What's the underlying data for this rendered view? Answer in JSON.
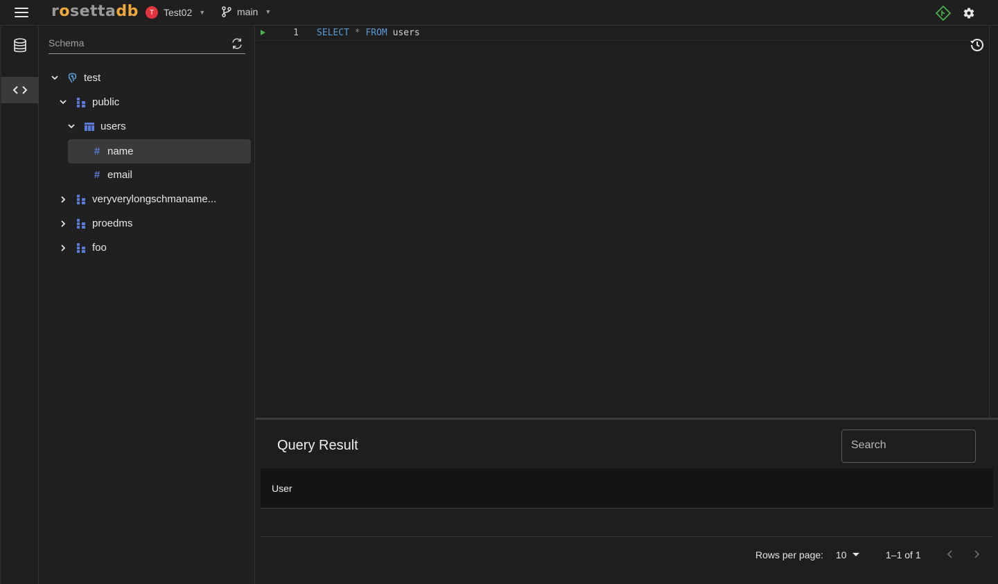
{
  "app": {
    "logo_part1": "r",
    "logo_part2": "setta",
    "logo_part3": "db",
    "org_avatar_letter": "T",
    "org_name": "Test02",
    "branch_name": "main"
  },
  "schema": {
    "search_placeholder": "Schema",
    "tree": {
      "database": "test",
      "schema_public": "public",
      "table_users": "users",
      "column_name": "name",
      "column_email": "email",
      "schema_long": "veryverylongschmaname...",
      "schema_proedms": "proedms",
      "schema_foo": "foo"
    }
  },
  "editor": {
    "line_number": "1",
    "code": {
      "kw1": "SELECT",
      "op": "*",
      "kw2": "FROM",
      "ident": "users"
    }
  },
  "result": {
    "title": "Query Result",
    "search_placeholder": "Search",
    "column_header": "User",
    "rows_per_page_label": "Rows per page:",
    "rows_per_page_value": "10",
    "range_text": "1–1 of 1"
  },
  "colors": {
    "accent_orange": "#f0a83c",
    "avatar_red": "#e0353f",
    "keyword_blue": "#5a9bd6",
    "icon_blue": "#5b7bd9",
    "run_green": "#4caf50"
  }
}
